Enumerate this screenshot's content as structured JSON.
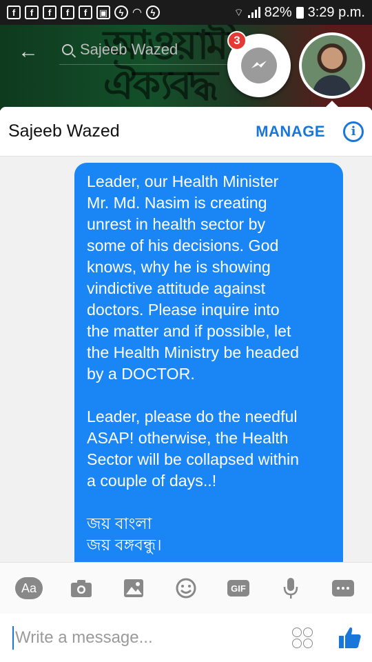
{
  "status_bar": {
    "notification_icons": [
      "f",
      "f",
      "f",
      "f",
      "f",
      "gallery",
      "messenger",
      "wifi",
      "messenger"
    ],
    "battery": "82%",
    "time": "3:29 p.m."
  },
  "header": {
    "search_text": "Sajeeb Wazed",
    "badge_count": "3"
  },
  "conversation": {
    "contact_name": "Sajeeb Wazed",
    "manage_label": "MANAGE",
    "info_label": "i"
  },
  "message": {
    "paragraphs": [
      [
        "Leader, our Health Minister",
        "Mr. Md. Nasim is creating",
        "unrest in health sector by",
        "some of his decisions. God",
        "knows, why he is showing",
        "vindictive attitude against",
        "doctors. Please inquire into",
        "the matter and if possible, let",
        "the Health Ministry be headed",
        "by a DOCTOR."
      ],
      [
        "Leader, please do the needful",
        "ASAP! otherwise, the Health",
        "Sector will be collapsed within",
        "a couple of days..!"
      ],
      [
        "জয় বাংলা",
        "জয় বঙ্গবন্ধু।"
      ]
    ]
  },
  "composer": {
    "aa_label": "Aa",
    "gif_label": "GIF",
    "placeholder": "Write a message..."
  },
  "colors": {
    "accent": "#1877d8",
    "bubble": "#1a86f5",
    "badge": "#e53935"
  }
}
